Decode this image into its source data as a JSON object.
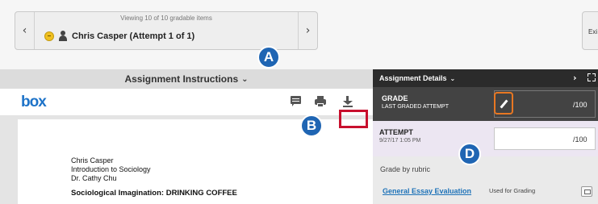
{
  "navigator": {
    "viewing_text": "Viewing 10 of 10 gradable items",
    "student_attempt": "Chris Casper (Attempt 1 of 1)",
    "prev_glyph": "‹",
    "next_glyph": "›"
  },
  "exit_label": "Exi",
  "callouts": {
    "a": "A",
    "b": "B",
    "d": "D"
  },
  "instructions": {
    "label": "Assignment Instructions",
    "chevron": "⌄"
  },
  "viewer": {
    "logo": "box"
  },
  "document": {
    "lines": [
      "Chris Casper",
      "Introduction to Sociology",
      "Dr. Cathy Chu"
    ],
    "title": "Sociological Imagination: DRINKING COFFEE"
  },
  "panel": {
    "header": "Assignment Details",
    "chevron": "⌄",
    "next_glyph": "›",
    "grade": {
      "label": "GRADE",
      "sub": "LAST GRADED ATTEMPT",
      "max": "/100"
    },
    "attempt": {
      "label": "ATTEMPT",
      "date": "9/27/17 1:05 PM",
      "max": "/100"
    },
    "rubric": {
      "grade_by": "Grade by rubric",
      "name": "General Essay Evaluation",
      "used_for": "Used for Grading"
    }
  },
  "colors": {
    "accent": "#1f65b3",
    "highlight_box": "#c8102e",
    "pencil_border": "#e87722",
    "panel_dark": "#2b2b2b"
  },
  "icons": [
    "status-dot-icon",
    "person-icon",
    "comment-icon",
    "print-icon",
    "download-icon",
    "pencil-icon",
    "expand-icon",
    "rubric-icon"
  ]
}
